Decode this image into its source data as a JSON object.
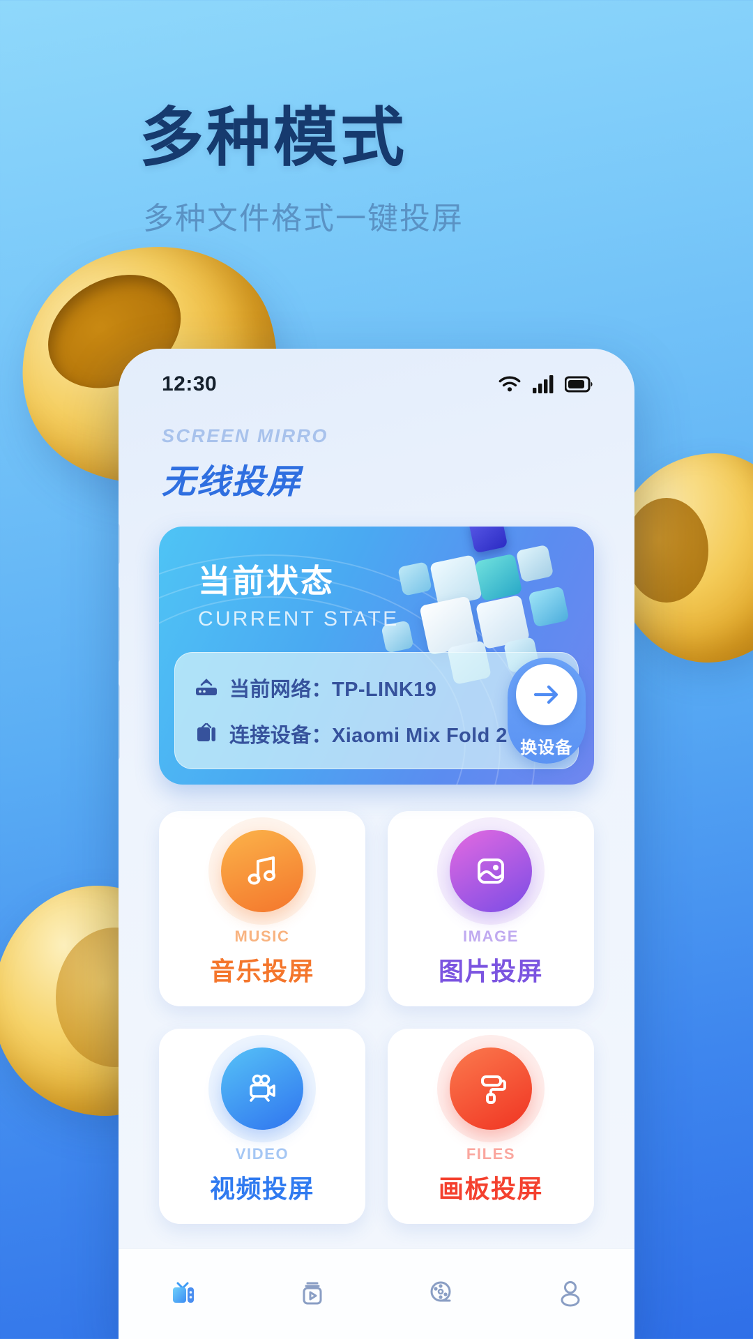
{
  "promo": {
    "title": "多种模式",
    "subtitle": "多种文件格式一键投屏",
    "title_color": "#163a6e",
    "subtitle_color": "#5a92c4"
  },
  "statusbar": {
    "time": "12:30",
    "icons": [
      "wifi-icon",
      "cellular-signal-icon",
      "battery-icon"
    ]
  },
  "app_header": {
    "kicker": "SCREEN MIRRO",
    "title": "无线投屏",
    "accent_color": "#2f6fe0"
  },
  "state_card": {
    "title": "当前状态",
    "title_en": "CURRENT STATE",
    "rows": [
      {
        "icon": "router-icon",
        "label": "当前网络：TP-LINK19"
      },
      {
        "icon": "tv-icon",
        "label": "连接设备：Xiaomi Mix Fold 2"
      }
    ],
    "switch_button": {
      "label": "换设备",
      "icon": "arrow-right-icon"
    }
  },
  "tiles": [
    {
      "en": "MUSIC",
      "cn": "音乐投屏",
      "icon": "music-note-icon",
      "color": "#f58634",
      "grad_from": "#fbb34a",
      "grad_to": "#f4762c"
    },
    {
      "en": "IMAGE",
      "cn": "图片投屏",
      "icon": "photo-icon",
      "color": "#7b54e0",
      "grad_from": "#e46ae0",
      "grad_to": "#7a4ce6"
    },
    {
      "en": "VIDEO",
      "cn": "视频投屏",
      "icon": "video-camera-icon",
      "color": "#2f7af0",
      "grad_from": "#56c2f7",
      "grad_to": "#2f74ef"
    },
    {
      "en": "FILES",
      "cn": "画板投屏",
      "icon": "paint-roller-icon",
      "color": "#f4402e",
      "grad_from": "#fb7a4e",
      "grad_to": "#f03422"
    }
  ],
  "tabbar": {
    "items": [
      {
        "icon": "tv-cast-icon",
        "active": true
      },
      {
        "icon": "media-play-box-icon",
        "active": false
      },
      {
        "icon": "film-reel-icon",
        "active": false
      },
      {
        "icon": "person-icon",
        "active": false
      }
    ],
    "active_color": "#3d9bf5",
    "inactive_color": "#8a9ec4"
  }
}
